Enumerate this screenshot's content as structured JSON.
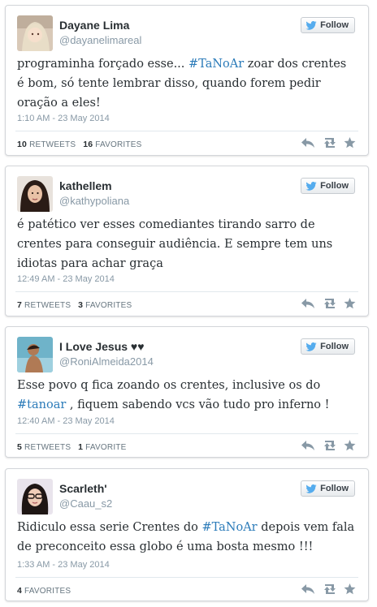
{
  "follow_label": "Follow",
  "tweets": [
    {
      "name": "Dayane Lima",
      "handle": "@dayanelimareal",
      "text_parts": [
        "programinha forçado esse... ",
        "#TaNoAr",
        " zoar dos crentes é bom, só tente lembrar disso, quando forem pedir oração a eles!"
      ],
      "time": "1:10 AM - 23 May 2014",
      "retweets_count": "10",
      "retweets_label": "RETWEETS",
      "favorites_count": "16",
      "favorites_label": "FAVORITES"
    },
    {
      "name": "kathellem",
      "handle": "@kathypoliana",
      "text_parts": [
        "é patético ver esses comediantes tirando sarro de crentes para conseguir audiência. E sempre tem uns idiotas para achar graça"
      ],
      "time": "12:49 AM - 23 May 2014",
      "retweets_count": "7",
      "retweets_label": "RETWEETS",
      "favorites_count": "3",
      "favorites_label": "FAVORITES"
    },
    {
      "name": "I Love Jesus ♥♥",
      "handle": "@RoniAlmeida2014",
      "text_parts": [
        "Esse povo q fica zoando os crentes, inclusive os do ",
        "#tanoar",
        " , fiquem sabendo vcs vão tudo pro inferno !"
      ],
      "time": "12:40 AM - 23 May 2014",
      "retweets_count": "5",
      "retweets_label": "RETWEETS",
      "favorites_count": "1",
      "favorites_label": "FAVORITE"
    },
    {
      "name": "Scarleth'",
      "handle": "@Caau_s2",
      "text_parts": [
        "Ridiculo essa serie Crentes do ",
        "#TaNoAr",
        "  depois vem fala de preconceito essa globo é uma bosta mesmo !!!"
      ],
      "time": "1:33 AM - 23 May 2014",
      "favorites_count": "4",
      "favorites_label": "FAVORITES"
    }
  ],
  "colors": {
    "link": "#2b7bb9",
    "bird": "#55acee",
    "action_icon": "#8899a6"
  },
  "icons": [
    "twitter-bird-icon",
    "reply-icon",
    "retweet-icon",
    "favorite-star-icon"
  ]
}
